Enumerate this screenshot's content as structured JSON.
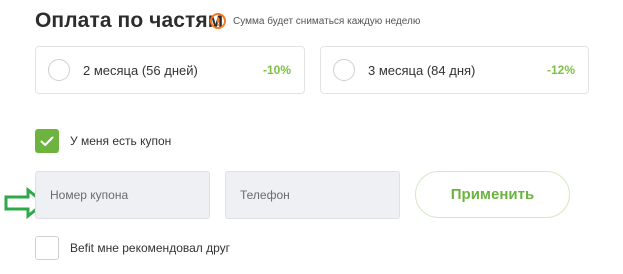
{
  "section": {
    "title": "Оплата по частям",
    "note_icon": "exclamation-circle-icon",
    "note": "Сумма будет сниматься каждую неделю"
  },
  "plans": [
    {
      "label": "2 месяца (56 дней)",
      "discount": "-10%",
      "selected": false
    },
    {
      "label": "3 месяца (84 дня)",
      "discount": "-12%",
      "selected": false
    }
  ],
  "coupon": {
    "checkbox_label": "У меня есть купон",
    "checked": true,
    "coupon_placeholder": "Номер купона",
    "phone_placeholder": "Телефон",
    "apply_label": "Применить"
  },
  "referral": {
    "checkbox_label": "Befit мне рекомендовал друг",
    "checked": false
  },
  "colors": {
    "accent_green": "#6db33f",
    "discount_green": "#7cc142",
    "warning_orange": "#f47a22",
    "annotation_arrow": "#2ea84a"
  }
}
